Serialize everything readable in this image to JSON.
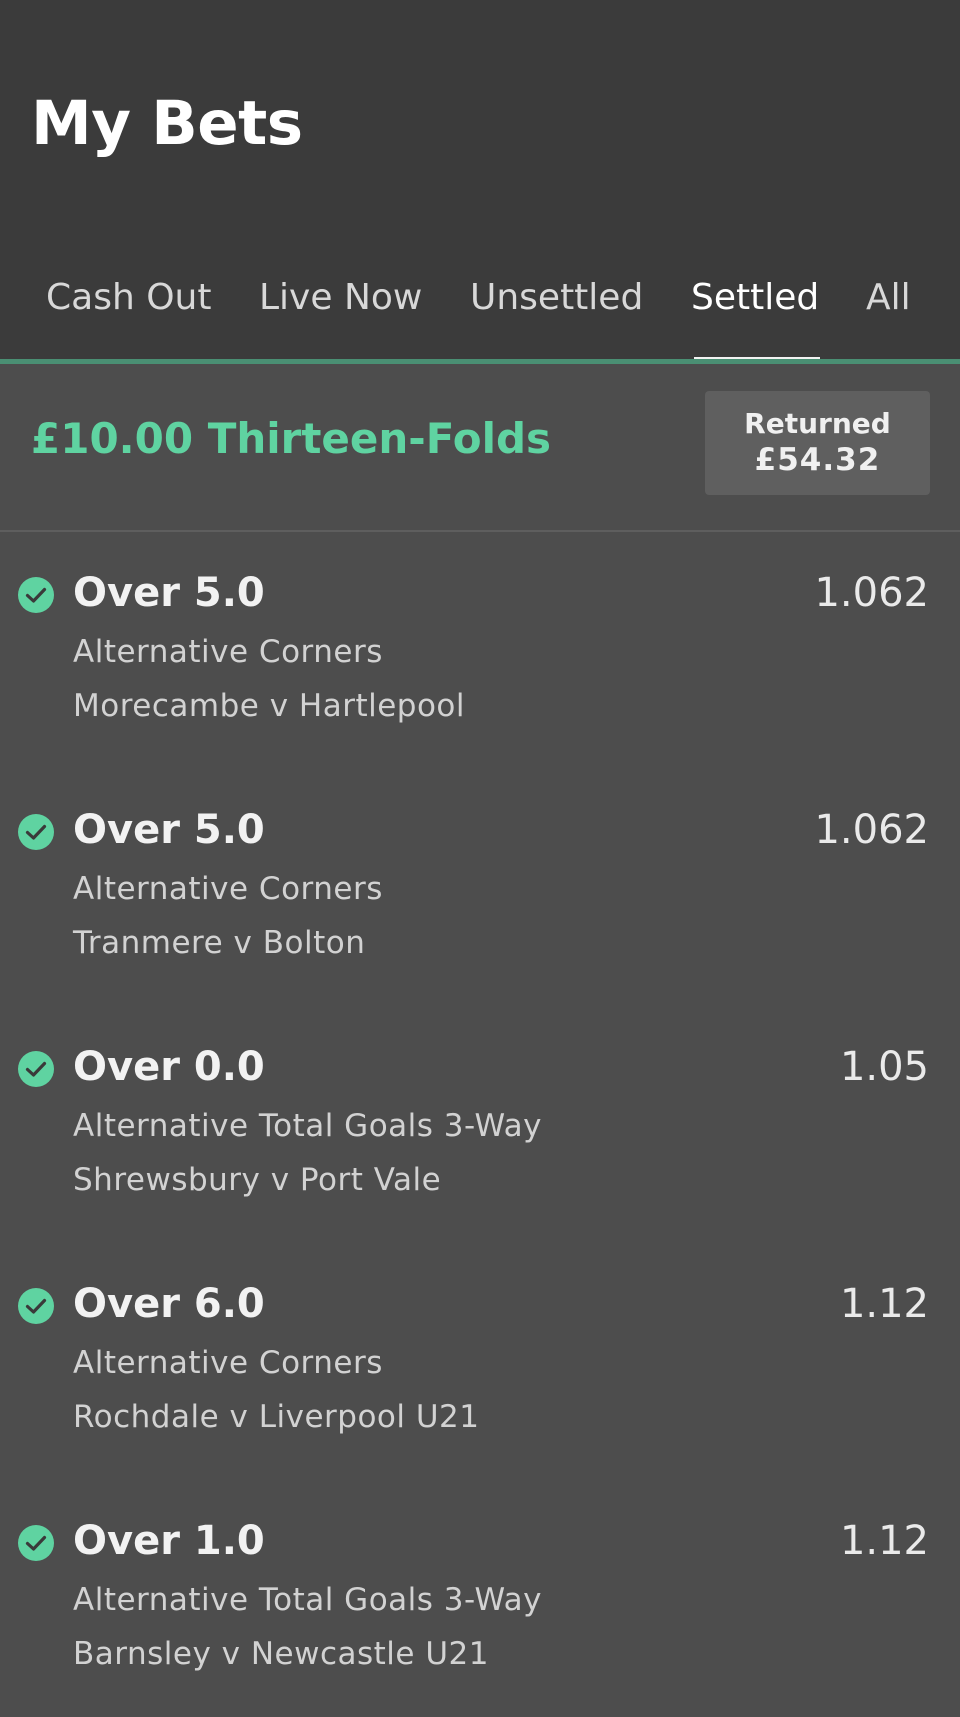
{
  "header": {
    "title": "My Bets"
  },
  "tabs": [
    {
      "label": "Cash Out",
      "active": false
    },
    {
      "label": "Live Now",
      "active": false
    },
    {
      "label": "Unsettled",
      "active": false
    },
    {
      "label": "Settled",
      "active": true
    },
    {
      "label": "All",
      "active": false
    }
  ],
  "bet": {
    "title": "£10.00 Thirteen-Folds",
    "returned_label": "Returned",
    "returned_amount": "£54.32",
    "legs": [
      {
        "selection": "Over 5.0",
        "odds": "1.062",
        "market": "Alternative Corners",
        "event": "Morecambe v Hartlepool",
        "status_icon": "check-circle-icon"
      },
      {
        "selection": "Over 5.0",
        "odds": "1.062",
        "market": "Alternative Corners",
        "event": "Tranmere v Bolton",
        "status_icon": "check-circle-icon"
      },
      {
        "selection": "Over 0.0",
        "odds": "1.05",
        "market": "Alternative Total Goals 3-Way",
        "event": "Shrewsbury v Port Vale",
        "status_icon": "check-circle-icon"
      },
      {
        "selection": "Over 6.0",
        "odds": "1.12",
        "market": "Alternative Corners",
        "event": "Rochdale v Liverpool U21",
        "status_icon": "check-circle-icon"
      },
      {
        "selection": "Over 1.0",
        "odds": "1.12",
        "market": "Alternative Total Goals 3-Way",
        "event": "Barnsley v Newcastle U21",
        "status_icon": "check-circle-icon"
      }
    ]
  },
  "colors": {
    "header_bg": "#3b3b3b",
    "content_bg": "#4d4d4d",
    "accent_green": "#5fd3a1",
    "tab_accent_line": "#4a8f73",
    "returned_box_bg": "#5f5f5f"
  }
}
